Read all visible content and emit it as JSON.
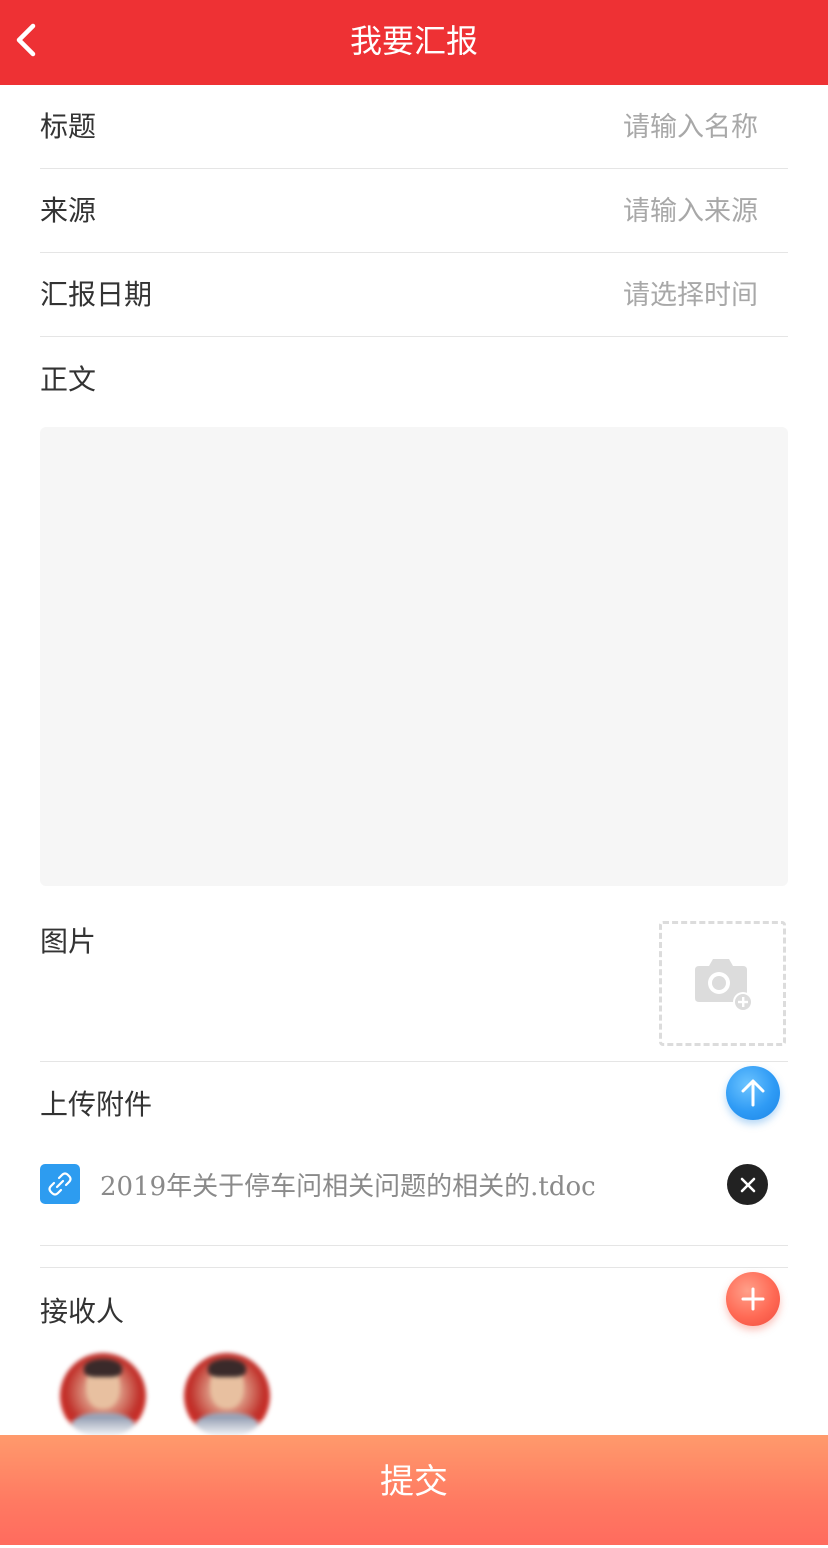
{
  "header": {
    "title": "我要汇报"
  },
  "form": {
    "title_label": "标题",
    "title_placeholder": "请输入名称",
    "source_label": "来源",
    "source_placeholder": "请输入来源",
    "date_label": "汇报日期",
    "date_placeholder": "请选择时间",
    "body_label": "正文",
    "image_label": "图片",
    "attachment_label": "上传附件",
    "recipient_label": "接收人"
  },
  "attachments": [
    {
      "name": "2019年关于停车问相关问题的相关的.tdoc",
      "icon": "link-icon"
    }
  ],
  "recipients_count": 2,
  "submit_label": "提交",
  "colors": {
    "header": "#ee3134",
    "upload_button": "#2f9bf5",
    "add_button": "#ff6a55",
    "submit_button": "#ff7a62"
  }
}
